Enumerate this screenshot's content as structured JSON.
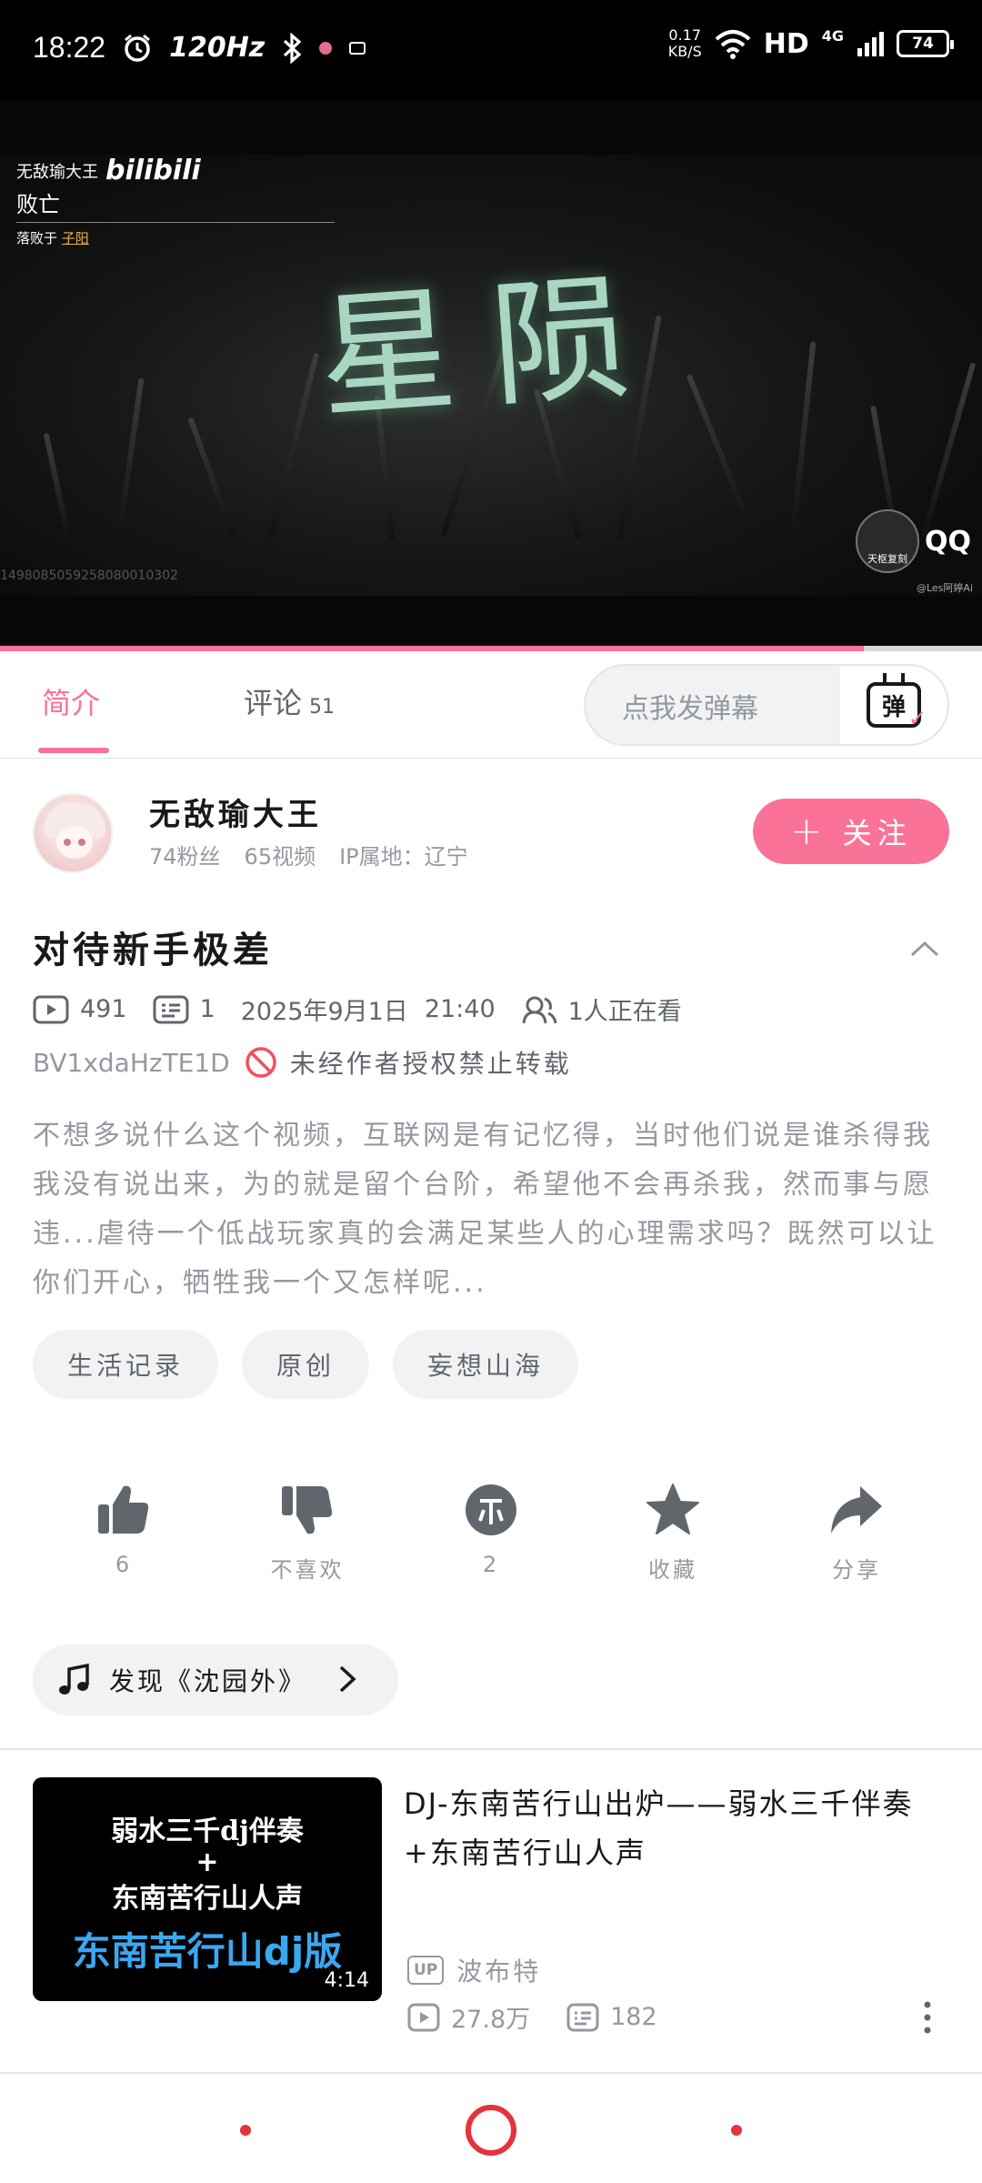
{
  "status_bar": {
    "time": "18:22",
    "refresh_rate": "120Hz",
    "net_speed_value": "0.17",
    "net_speed_unit": "KB/S",
    "network_type": "HD",
    "cell_gen": "4G",
    "battery": "74"
  },
  "video": {
    "overlay_uploader": "无敌瑜大王",
    "overlay_logo": "bilibili",
    "overlay_status": "败亡",
    "overlay_defeated_prefix": "落败于",
    "overlay_defeated_by": "子阳",
    "title_art": "星陨",
    "video_id": "1498085059258080010302",
    "watermark": "QQ",
    "watermark_sub": "天枢复刻",
    "credit": "@Les阿婷Ai",
    "progress_percent": 88
  },
  "tabs": {
    "intro": "简介",
    "comments": "评论",
    "comments_count": "51",
    "danmaku_placeholder": "点我发弹幕",
    "danmaku_icon_char": "弹"
  },
  "uploader": {
    "name": "无敌瑜大王",
    "fans": "74粉丝",
    "videos": "65视频",
    "ip": "IP属地：辽宁",
    "follow_label": "关注"
  },
  "video_info": {
    "title": "对待新手极差",
    "views": "491",
    "danmaku": "1",
    "date": "2025年9月1日",
    "time": "21:40",
    "watching": "1人正在看",
    "bvid": "BV1xdaHzTE1D",
    "repost_notice": "未经作者授权禁止转载",
    "description": "不想多说什么这个视频，互联网是有记忆得，当时他们说是谁杀得我我没有说出来，为的就是留个台阶，希望他不会再杀我，然而事与愿违...虐待一个低战玩家真的会满足某些人的心理需求吗？既然可以让你们开心，牺牲我一个又怎样呢...",
    "tags": [
      "生活记录",
      "原创",
      "妄想山海"
    ]
  },
  "actions": {
    "like": "6",
    "dislike": "不喜欢",
    "coin": "2",
    "favorite": "收藏",
    "share": "分享"
  },
  "music": {
    "label": "发现《沈园外》"
  },
  "recommended": {
    "thumb_line1": "弱水三千dj伴奏",
    "thumb_line2": "+",
    "thumb_line3": "东南苦行山人声",
    "thumb_line4": "东南苦行山dj版",
    "duration": "4:14",
    "title": "DJ-东南苦行山出炉——弱水三千伴奏+东南苦行山人声",
    "up_badge": "UP",
    "uploader": "波布特",
    "views": "27.8万",
    "danmaku": "182"
  },
  "colors": {
    "accent": "#fb7299",
    "text_primary": "#18191c",
    "text_secondary": "#61666d",
    "text_tertiary": "#9499a0",
    "nav_red": "#e5323b"
  }
}
